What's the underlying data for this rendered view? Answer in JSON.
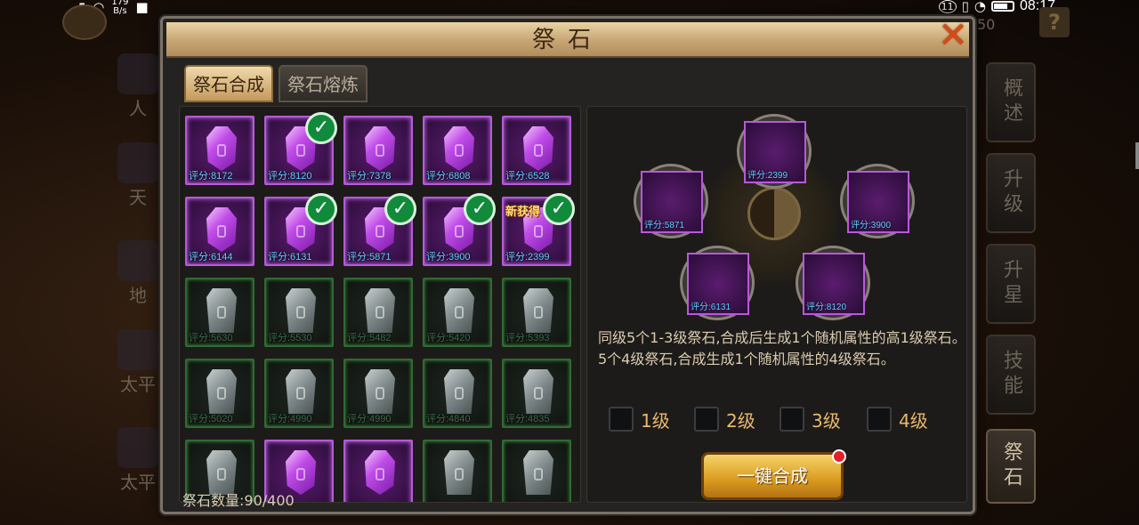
{
  "status_bar": {
    "network": "5G",
    "speed_value": "179",
    "speed_unit": "B/s",
    "battery_saver": "11",
    "time": "08:17"
  },
  "background": {
    "left_labels": [
      "人",
      "天",
      "地",
      "太平",
      "太平"
    ],
    "right_number": "50",
    "help_icon": "?",
    "side_tabs": [
      {
        "label": "概述",
        "active": false
      },
      {
        "label": "升级",
        "active": false
      },
      {
        "label": "升星",
        "active": false
      },
      {
        "label": "技能",
        "active": false
      },
      {
        "label": "祭石",
        "active": true
      }
    ]
  },
  "dialog": {
    "title": "祭石",
    "close_icon": "close-x-icon",
    "tabs": [
      {
        "label": "祭石合成",
        "active": true
      },
      {
        "label": "祭石熔炼",
        "active": false
      }
    ],
    "grid": [
      [
        {
          "rarity": "purple",
          "score": "评分:8172",
          "checked": false
        },
        {
          "rarity": "purple",
          "score": "评分:8120",
          "checked": true
        },
        {
          "rarity": "purple",
          "score": "评分:7378",
          "checked": false
        },
        {
          "rarity": "purple",
          "score": "评分:6808",
          "checked": false
        },
        {
          "rarity": "purple",
          "score": "评分:6528",
          "checked": false
        }
      ],
      [
        {
          "rarity": "purple",
          "score": "评分:6144",
          "checked": false
        },
        {
          "rarity": "purple",
          "score": "评分:6131",
          "checked": true
        },
        {
          "rarity": "purple",
          "score": "评分:5871",
          "checked": true
        },
        {
          "rarity": "purple",
          "score": "评分:3900",
          "checked": true
        },
        {
          "rarity": "purple",
          "score": "评分:2399",
          "checked": true,
          "tag": "新获得"
        }
      ],
      [
        {
          "rarity": "green",
          "score": "评分:5630",
          "checked": false
        },
        {
          "rarity": "green",
          "score": "评分:5530",
          "checked": false
        },
        {
          "rarity": "green",
          "score": "评分:5482",
          "checked": false
        },
        {
          "rarity": "green",
          "score": "评分:5420",
          "checked": false
        },
        {
          "rarity": "green",
          "score": "评分:5393",
          "checked": false
        }
      ],
      [
        {
          "rarity": "green",
          "score": "评分:5020",
          "checked": false
        },
        {
          "rarity": "green",
          "score": "评分:4990",
          "checked": false
        },
        {
          "rarity": "green",
          "score": "评分:4990",
          "checked": false
        },
        {
          "rarity": "green",
          "score": "评分:4840",
          "checked": false
        },
        {
          "rarity": "green",
          "score": "评分:4835",
          "checked": false
        }
      ],
      [
        {
          "rarity": "green",
          "score": "",
          "checked": false
        },
        {
          "rarity": "purple",
          "score": "",
          "checked": false
        },
        {
          "rarity": "purple",
          "score": "",
          "checked": false
        },
        {
          "rarity": "green",
          "score": "",
          "checked": false
        },
        {
          "rarity": "green",
          "score": "",
          "checked": false
        }
      ]
    ],
    "count_label": "祭石数量:90/400",
    "slots": [
      {
        "score": "评分:2399"
      },
      {
        "score": "评分:5871"
      },
      {
        "score": "评分:3900"
      },
      {
        "score": "评分:6131"
      },
      {
        "score": "评分:8120"
      }
    ],
    "description": "同级5个1-3级祭石,合成后生成1个随机属性的高1级祭石。5个4级祭石,合成生成1个随机属性的4级祭石。",
    "levels": [
      "1级",
      "2级",
      "3级",
      "4级"
    ],
    "merge_button": "一键合成"
  }
}
